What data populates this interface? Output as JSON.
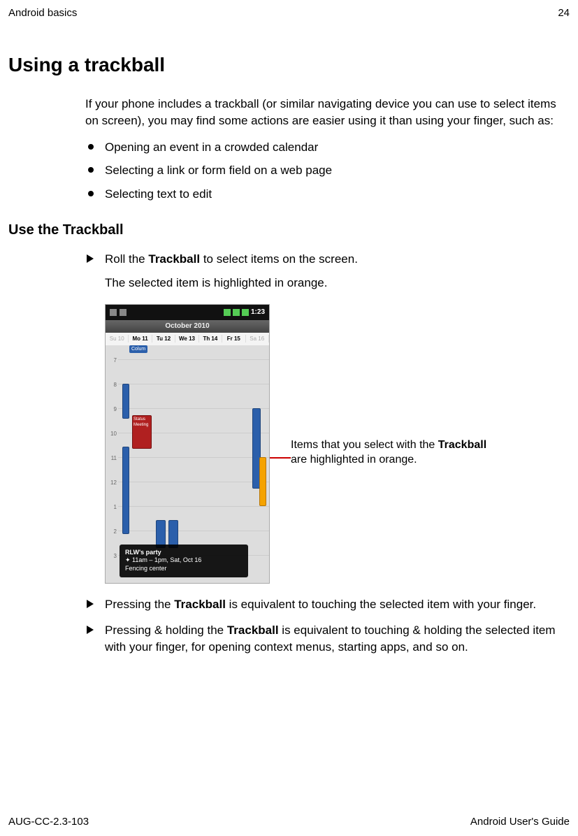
{
  "header": {
    "section": "Android basics",
    "page": "24"
  },
  "title": "Using a trackball",
  "intro": "If your phone includes a trackball (or similar navigating device you can use to select items on screen), you may find some actions are easier using it than using your finger, such as:",
  "bullets": [
    "Opening an event in a crowded calendar",
    "Selecting a link or form field on a web page",
    "Selecting text to edit"
  ],
  "subhead": "Use the Trackball",
  "steps": {
    "s1_pre": "Roll the ",
    "s1_bold": "Trackball",
    "s1_post": " to select items on the screen.",
    "s1_sub": "The selected item is highlighted in orange.",
    "s2_pre": "Pressing the ",
    "s2_bold": "Trackball",
    "s2_post": " is equivalent to touching the selected item with your finger.",
    "s3_pre": "Pressing & holding the ",
    "s3_bold": "Trackball",
    "s3_post": " is equivalent to touching & holding the selected item with your finger, for opening context menus, starting apps, and so on."
  },
  "screenshot": {
    "time": "1:23",
    "month": "October 2010",
    "days": [
      "Su 10",
      "Mo 11",
      "Tu 12",
      "We 13",
      "Th 14",
      "Fr 15",
      "Sa 16"
    ],
    "badge": "Colum",
    "hours": [
      "7",
      "8",
      "9",
      "10",
      "11",
      "12",
      "1",
      "2",
      "3"
    ],
    "red_event": "Status Meeting",
    "popup_title": "RLW's party",
    "popup_time": "✦ 11am – 1pm, Sat, Oct 16",
    "popup_loc": "Fencing center"
  },
  "callout": {
    "pre": "Items that you select with the ",
    "bold": "Trackball",
    "post": " are highlighted in orange."
  },
  "footer": {
    "left": "AUG-CC-2.3-103",
    "right": "Android User's Guide"
  }
}
